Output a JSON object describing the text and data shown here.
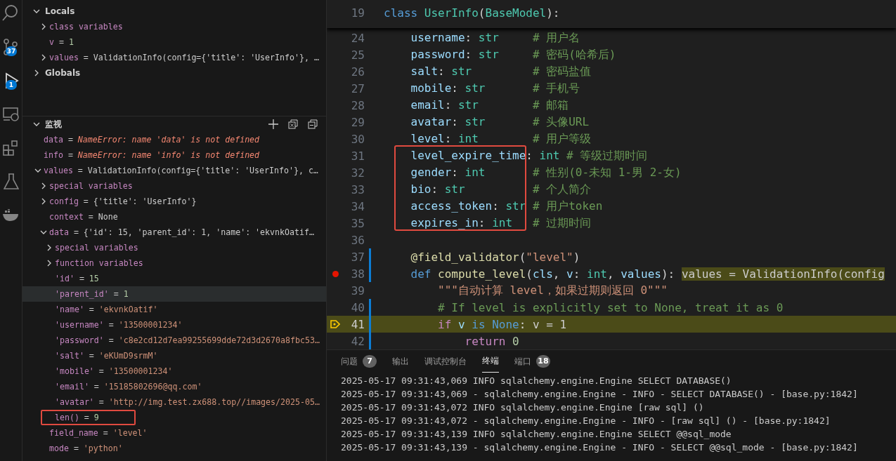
{
  "activity_bar": [
    {
      "kind": "search"
    },
    {
      "kind": "source-control",
      "badge": "37"
    },
    {
      "kind": "debug",
      "badge": "1"
    },
    {
      "kind": "remote"
    },
    {
      "kind": "extensions"
    },
    {
      "kind": "testing"
    },
    {
      "kind": "docker"
    }
  ],
  "variables": {
    "sections": [
      {
        "title": "Locals",
        "expanded": true,
        "children": [
          {
            "name": "class variables",
            "kind": "group",
            "expanded": false
          },
          {
            "name": "v",
            "sep": "=",
            "value": "1",
            "kind": "number"
          },
          {
            "name": "values",
            "sep": "=",
            "value": "ValidationInfo(config={'title': 'UserInfo'}, …",
            "kind": "plain",
            "expanded": false
          }
        ]
      },
      {
        "title": "Globals",
        "expanded": false
      }
    ]
  },
  "watch": {
    "title": "监视",
    "items": [
      {
        "name": "data",
        "sep": "=",
        "value": "NameError: name 'data' is not defined",
        "kind": "error"
      },
      {
        "name": "info",
        "sep": "=",
        "value": "NameError: name 'info' is not defined",
        "kind": "error"
      },
      {
        "name": "values",
        "sep": "=",
        "value": "ValidationInfo(config={'title': 'UserInfo'}, c…",
        "kind": "plain",
        "expanded": true,
        "children": [
          {
            "name": "special variables",
            "kind": "group",
            "expanded": false
          },
          {
            "name": "config",
            "sep": "=",
            "value": "{'title': 'UserInfo'}",
            "kind": "plain",
            "expanded": false
          },
          {
            "name": "context",
            "sep": "=",
            "value": "None",
            "kind": "plain"
          },
          {
            "name": "data",
            "sep": "=",
            "value": "{'id': 15, 'parent_id': 1, 'name': 'ekvnkOatif…",
            "kind": "plain",
            "expanded": true,
            "children": [
              {
                "name": "special variables",
                "kind": "group",
                "expanded": false,
                "highlighted": false,
                "marked": false
              },
              {
                "name": "function variables",
                "kind": "group",
                "expanded": false,
                "highlighted": false,
                "marked": false
              },
              {
                "name": "'id'",
                "sep": "=",
                "value": "15",
                "kind": "number",
                "highlighted": false,
                "marked": false
              },
              {
                "name": "'parent_id'",
                "sep": "=",
                "value": "1",
                "kind": "number",
                "highlighted": true,
                "marked": false
              },
              {
                "name": "'name'",
                "sep": "=",
                "value": "'ekvnkOatif'",
                "kind": "string",
                "highlighted": false,
                "marked": false
              },
              {
                "name": "'username'",
                "sep": "=",
                "value": "'13500001234'",
                "kind": "string",
                "highlighted": false,
                "marked": false
              },
              {
                "name": "'password'",
                "sep": "=",
                "value": "'c8e2cd12d7ea99255699dde72d3d2670a8fbc53…",
                "kind": "string",
                "highlighted": false,
                "marked": false
              },
              {
                "name": "'salt'",
                "sep": "=",
                "value": "'eKUmD9srmM'",
                "kind": "string",
                "highlighted": false,
                "marked": false
              },
              {
                "name": "'mobile'",
                "sep": "=",
                "value": "'13500001234'",
                "kind": "string",
                "highlighted": false,
                "marked": false
              },
              {
                "name": "'email'",
                "sep": "=",
                "value": "'15185802696@qq.com'",
                "kind": "string",
                "highlighted": false,
                "marked": false
              },
              {
                "name": "'avatar'",
                "sep": "=",
                "value": "'http://img.test.zx688.top//images/2025-05…",
                "kind": "string",
                "highlighted": false,
                "marked": false
              },
              {
                "name": "len()",
                "sep": "=",
                "value": "9",
                "kind": "number",
                "highlighted": false,
                "marked": true
              }
            ]
          },
          {
            "name": "field_name",
            "sep": "=",
            "value": "'level'",
            "kind": "string"
          },
          {
            "name": "mode",
            "sep": "=",
            "value": "'python'",
            "kind": "string"
          }
        ]
      }
    ]
  },
  "editor": {
    "sticky": {
      "n": "19",
      "tokens": [
        {
          "kind": "kw",
          "text": "class "
        },
        {
          "kind": "cls",
          "text": "UserInfo"
        },
        {
          "kind": "pl",
          "text": "("
        },
        {
          "kind": "cls",
          "text": "BaseModel"
        },
        {
          "kind": "pl",
          "text": "):"
        }
      ]
    },
    "lines": [
      {
        "n": "24",
        "tokens": [
          {
            "kind": "var",
            "text": "    username"
          },
          {
            "kind": "pl",
            "text": ": "
          },
          {
            "kind": "cls",
            "text": "str"
          },
          {
            "kind": "cm",
            "text": "     # 用户名"
          }
        ]
      },
      {
        "n": "25",
        "tokens": [
          {
            "kind": "var",
            "text": "    password"
          },
          {
            "kind": "pl",
            "text": ": "
          },
          {
            "kind": "cls",
            "text": "str"
          },
          {
            "kind": "cm",
            "text": "     # 密码(哈希后)"
          }
        ]
      },
      {
        "n": "26",
        "tokens": [
          {
            "kind": "var",
            "text": "    salt"
          },
          {
            "kind": "pl",
            "text": ": "
          },
          {
            "kind": "cls",
            "text": "str"
          },
          {
            "kind": "cm",
            "text": "         # 密码盐值"
          }
        ]
      },
      {
        "n": "27",
        "tokens": [
          {
            "kind": "var",
            "text": "    mobile"
          },
          {
            "kind": "pl",
            "text": ": "
          },
          {
            "kind": "cls",
            "text": "str"
          },
          {
            "kind": "cm",
            "text": "       # 手机号"
          }
        ]
      },
      {
        "n": "28",
        "tokens": [
          {
            "kind": "var",
            "text": "    email"
          },
          {
            "kind": "pl",
            "text": ": "
          },
          {
            "kind": "cls",
            "text": "str"
          },
          {
            "kind": "cm",
            "text": "        # 邮箱"
          }
        ]
      },
      {
        "n": "29",
        "tokens": [
          {
            "kind": "var",
            "text": "    avatar"
          },
          {
            "kind": "pl",
            "text": ": "
          },
          {
            "kind": "cls",
            "text": "str"
          },
          {
            "kind": "cm",
            "text": "       # 头像URL"
          }
        ]
      },
      {
        "n": "30",
        "tokens": [
          {
            "kind": "var",
            "text": "    level"
          },
          {
            "kind": "pl",
            "text": ": "
          },
          {
            "kind": "cls",
            "text": "int"
          },
          {
            "kind": "cm",
            "text": "        # 用户等级"
          }
        ]
      },
      {
        "n": "31",
        "marked": true,
        "tokens": [
          {
            "kind": "var",
            "text": "    level_expire_time"
          },
          {
            "kind": "pl",
            "text": ": "
          },
          {
            "kind": "cls",
            "text": "int"
          },
          {
            "kind": "cm",
            "text": " # 等级过期时间"
          }
        ]
      },
      {
        "n": "32",
        "marked": true,
        "tokens": [
          {
            "kind": "var",
            "text": "    gender"
          },
          {
            "kind": "pl",
            "text": ": "
          },
          {
            "kind": "cls",
            "text": "int"
          },
          {
            "kind": "cm",
            "text": "       # 性别(0-未知 1-男 2-女)"
          }
        ]
      },
      {
        "n": "33",
        "marked": true,
        "tokens": [
          {
            "kind": "var",
            "text": "    bio"
          },
          {
            "kind": "pl",
            "text": ": "
          },
          {
            "kind": "cls",
            "text": "str"
          },
          {
            "kind": "cm",
            "text": "          # 个人简介"
          }
        ]
      },
      {
        "n": "34",
        "marked": true,
        "tokens": [
          {
            "kind": "var",
            "text": "    access_token"
          },
          {
            "kind": "pl",
            "text": ": "
          },
          {
            "kind": "cls",
            "text": "str"
          },
          {
            "kind": "cm",
            "text": " # 用户token"
          }
        ]
      },
      {
        "n": "35",
        "marked": true,
        "tokens": [
          {
            "kind": "var",
            "text": "    expires_in"
          },
          {
            "kind": "pl",
            "text": ": "
          },
          {
            "kind": "cls",
            "text": "int"
          },
          {
            "kind": "cm",
            "text": "   # 过期时间"
          }
        ]
      },
      {
        "n": "36"
      },
      {
        "n": "37",
        "modified": true,
        "tokens": [
          {
            "kind": "fn",
            "text": "    @field_validator"
          },
          {
            "kind": "pl",
            "text": "("
          },
          {
            "kind": "str",
            "text": "\"level\""
          },
          {
            "kind": "pl",
            "text": ")"
          }
        ]
      },
      {
        "n": "38",
        "modified": true,
        "breakpoint": true,
        "tokens": [
          {
            "kind": "kw",
            "text": "    def "
          },
          {
            "kind": "fn",
            "text": "compute_level"
          },
          {
            "kind": "pl",
            "text": "("
          },
          {
            "kind": "var",
            "text": "cls"
          },
          {
            "kind": "pl",
            "text": ", "
          },
          {
            "kind": "var",
            "text": "v"
          },
          {
            "kind": "pl",
            "text": ": "
          },
          {
            "kind": "cls",
            "text": "int"
          },
          {
            "kind": "pl",
            "text": ", "
          },
          {
            "kind": "var",
            "text": "values"
          },
          {
            "kind": "pl",
            "text": "): "
          }
        ],
        "inline_value": "values = ValidationInfo(config"
      },
      {
        "n": "39",
        "tokens": [
          {
            "kind": "str",
            "text": "        \"\"\"自动计算 level，如果过期则返回 0\"\"\""
          }
        ]
      },
      {
        "n": "40",
        "modified": true,
        "tokens": [
          {
            "kind": "cm",
            "text": "        # If level is explicitly set to None, treat it as 0"
          }
        ]
      },
      {
        "n": "41",
        "modified": true,
        "current": true,
        "tokens": [
          {
            "kind": "ctrl",
            "text": "        if "
          },
          {
            "kind": "var",
            "text": "v"
          },
          {
            "kind": "kw",
            "text": " is "
          },
          {
            "kind": "kw",
            "text": "None"
          },
          {
            "kind": "pl",
            "text": ": "
          }
        ],
        "inline_value": "v = 1"
      },
      {
        "n": "42",
        "modified": true,
        "tokens": [
          {
            "kind": "ctrl",
            "text": "            return "
          },
          {
            "kind": "num",
            "text": "0"
          }
        ]
      }
    ]
  },
  "panel": {
    "tabs": [
      {
        "label": "问题",
        "badge": "7",
        "selected": false
      },
      {
        "label": "输出",
        "selected": false
      },
      {
        "label": "调试控制台",
        "selected": false
      },
      {
        "label": "终端",
        "selected": true
      },
      {
        "label": "端口",
        "badge": "18",
        "selected": false
      }
    ],
    "terminal_lines": [
      "2025-05-17 09:31:43,069 INFO sqlalchemy.engine.Engine SELECT DATABASE()",
      "2025-05-17 09:31:43,069 - sqlalchemy.engine.Engine - INFO - SELECT DATABASE() - [base.py:1842]",
      "2025-05-17 09:31:43,072 INFO sqlalchemy.engine.Engine [raw sql] ()",
      "2025-05-17 09:31:43,072 - sqlalchemy.engine.Engine - INFO - [raw sql] () - [base.py:1842]",
      "2025-05-17 09:31:43,139 INFO sqlalchemy.engine.Engine SELECT @@sql_mode",
      "2025-05-17 09:31:43,139 - sqlalchemy.engine.Engine - INFO - SELECT @@sql_mode - [base.py:1842]"
    ]
  }
}
